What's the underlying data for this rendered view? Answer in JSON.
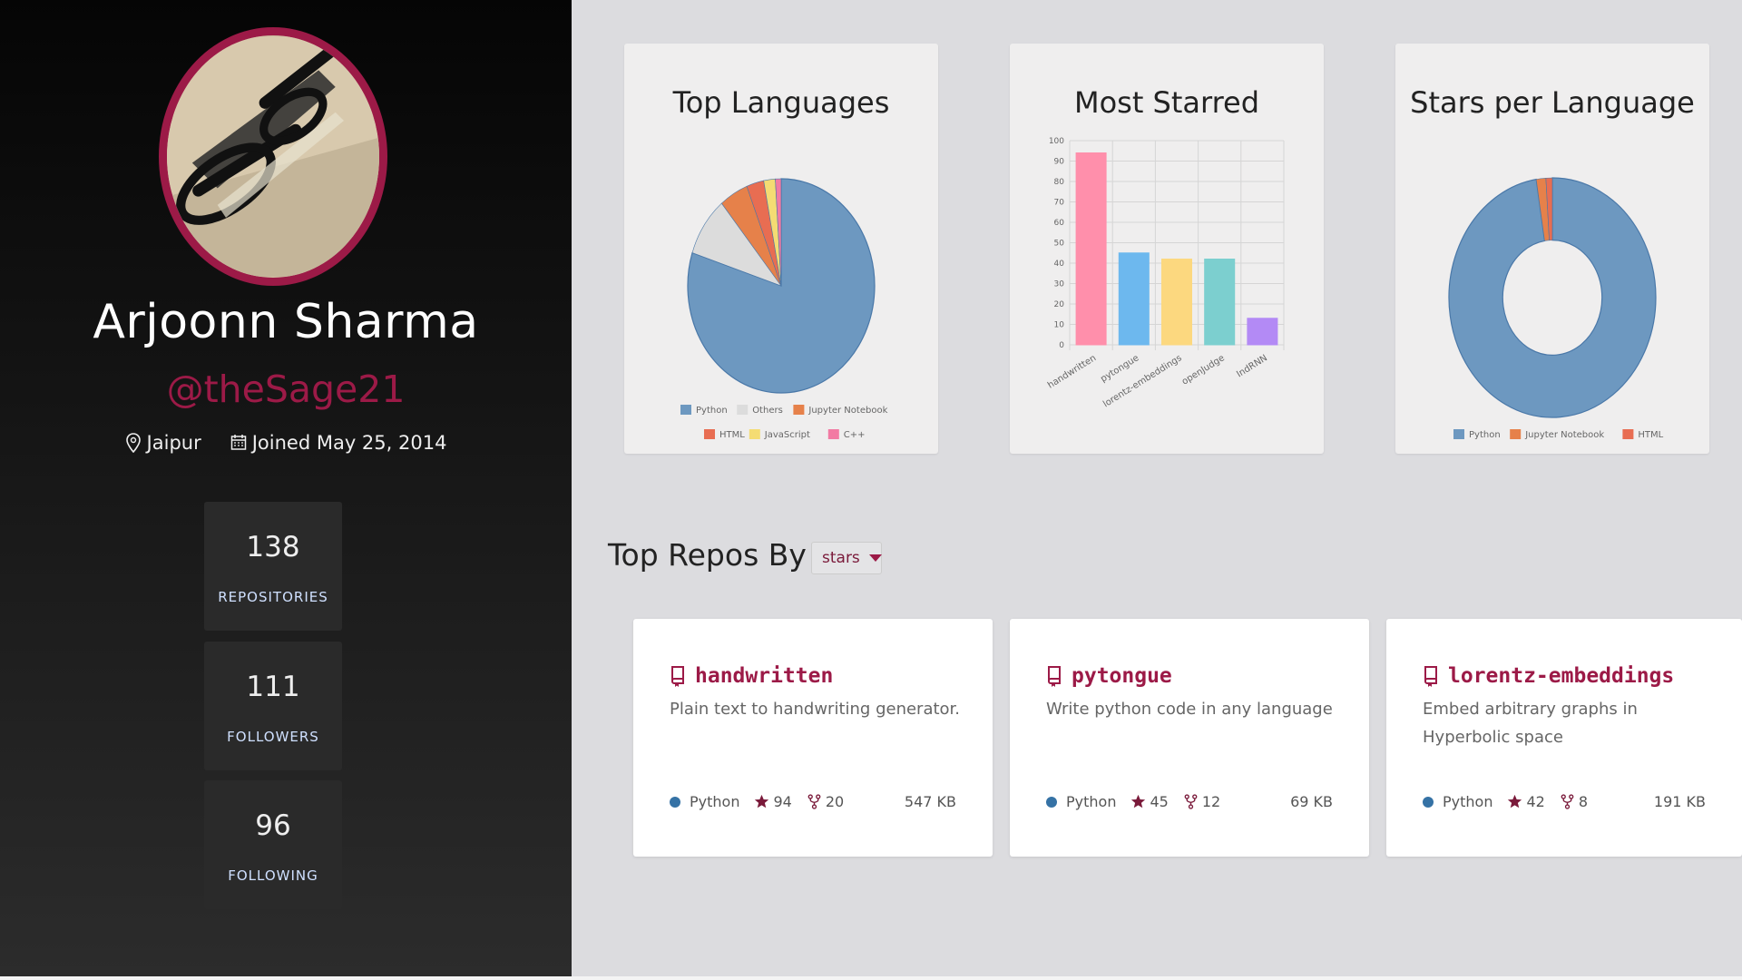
{
  "profile": {
    "name": "Arjoonn Sharma",
    "handle": "@theSage21",
    "location": "Jaipur",
    "joined": "Joined May 25, 2014",
    "avatar_icon": "eyeglasses-photo"
  },
  "stats": [
    {
      "value": "138",
      "label": "REPOSITORIES"
    },
    {
      "value": "111",
      "label": "FOLLOWERS"
    },
    {
      "value": "96",
      "label": "FOLLOWING"
    }
  ],
  "charts": {
    "top_languages_title": "Top Languages",
    "most_starred_title": "Most Starred",
    "stars_per_language_title": "Stars per Language"
  },
  "chart_data": [
    {
      "type": "pie",
      "title": "Top Languages",
      "categories": [
        "Python",
        "Others",
        "Jupyter Notebook",
        "HTML",
        "JavaScript",
        "C++"
      ],
      "values": [
        80,
        9,
        5,
        3,
        2,
        1
      ],
      "colors": [
        "#6d98c0",
        "#dcdcdc",
        "#e6814a",
        "#e86d52",
        "#f4dc73",
        "#f27aa3"
      ],
      "legend": "bottom"
    },
    {
      "type": "bar",
      "title": "Most Starred",
      "categories": [
        "handwritten",
        "pytongue",
        "lorentz-embeddings",
        "openJudge",
        "IndRNN"
      ],
      "values": [
        94,
        45,
        42,
        42,
        13
      ],
      "colors": [
        "#ff8fab",
        "#6db8ee",
        "#fcd87f",
        "#7ccfcf",
        "#b38af5"
      ],
      "yticks": [
        0,
        10,
        20,
        30,
        40,
        50,
        60,
        70,
        80,
        90,
        100
      ],
      "ylim": [
        0,
        100
      ],
      "grid": true
    },
    {
      "type": "pie",
      "title": "Stars per Language",
      "categories": [
        "Python",
        "Jupyter Notebook",
        "HTML"
      ],
      "values": [
        97.5,
        1.5,
        1.0
      ],
      "colors": [
        "#6d98c0",
        "#e6814a",
        "#e86d52"
      ],
      "legend": "bottom",
      "donut": true
    }
  ],
  "repos_section": {
    "title": "Top Repos By",
    "sort_value": "stars"
  },
  "repos": [
    {
      "name": "handwritten",
      "description": "Plain text to handwriting generator.",
      "language": "Python",
      "stars": "94",
      "forks": "20",
      "size": "547 KB"
    },
    {
      "name": "pytongue",
      "description": "Write python code in any language",
      "language": "Python",
      "stars": "45",
      "forks": "12",
      "size": "69 KB"
    },
    {
      "name": "lorentz-embeddings",
      "description": "Embed arbitrary graphs in Hyperbolic space",
      "language": "Python",
      "stars": "42",
      "forks": "8",
      "size": "191 KB"
    }
  ],
  "colors": {
    "accent": "#9c1a47",
    "python": "#3572A5"
  }
}
